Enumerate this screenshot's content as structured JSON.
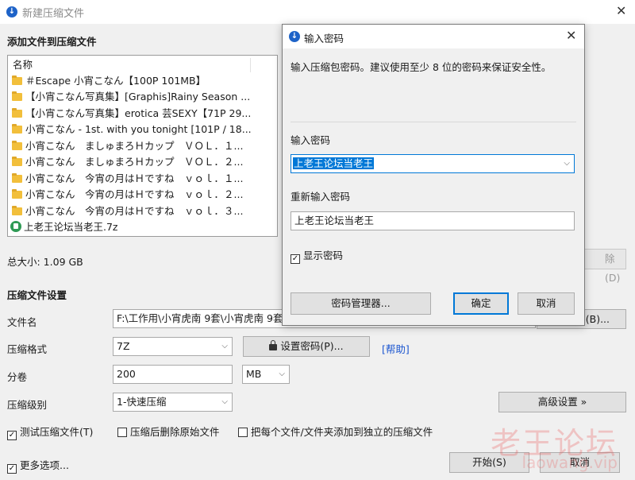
{
  "window": {
    "title": "新建压缩文件"
  },
  "files_section": {
    "heading": "添加文件到压缩文件",
    "column_name": "名称",
    "items": [
      {
        "name": "＃Escape 小宵こなん【100P 101MB】",
        "type": "folder"
      },
      {
        "name": "【小宵こなん写真集】[Graphis]Rainy Season ...",
        "type": "folder"
      },
      {
        "name": "【小宵こなん写真集】erotica 芸SEXY【71P 29...",
        "type": "folder"
      },
      {
        "name": "小宵こなん - 1st. with you tonight [101P / 18...",
        "type": "folder"
      },
      {
        "name": "小宵こなん　ましゅまろＨカップ　ＶＯＬ．１...",
        "type": "folder"
      },
      {
        "name": "小宵こなん　ましゅまろＨカップ　ＶＯＬ．２...",
        "type": "folder"
      },
      {
        "name": "小宵こなん　今宵の月はＨですね　ｖｏｌ．１...",
        "type": "folder"
      },
      {
        "name": "小宵こなん　今宵の月はＨですね　ｖｏｌ．２...",
        "type": "folder"
      },
      {
        "name": "小宵こなん　今宵の月はＨですね　ｖｏｌ．３...",
        "type": "folder"
      },
      {
        "name": "上老王论坛当老王.7z",
        "type": "archive"
      }
    ],
    "total_size": "总大小: 1.09 GB",
    "delete_label": "除(D)"
  },
  "settings": {
    "heading": "压缩文件设置",
    "filename_label": "文件名",
    "filename_value": "F:\\工作用\\小宵虎南 9套\\小宵虎南 9套",
    "browse_label": "览(B)...",
    "format_label": "压缩格式",
    "format_value": "7Z",
    "set_password_label": "设置密码(P)...",
    "help_label": "[帮助]",
    "split_label": "分卷",
    "split_value": "200",
    "split_unit": "MB",
    "level_label": "压缩级别",
    "level_value": "1-快速压缩",
    "advanced_label": "高级设置 »",
    "test_archive_label": "测试压缩文件(T)",
    "delete_source_label": "压缩后删除原始文件",
    "separate_archives_label": "把每个文件/文件夹添加到独立的压缩文件",
    "more_options_label": "更多选项...",
    "start_label": "开始(S)",
    "cancel_label": "取消"
  },
  "password_dialog": {
    "title": "输入密码",
    "description": "输入压缩包密码。建议使用至少 8 位的密码来保证安全性。",
    "password_label": "输入密码",
    "password_value": "上老王论坛当老王",
    "confirm_label": "重新输入密码",
    "confirm_value": "上老王论坛当老王",
    "show_password_label": "显示密码",
    "manager_label": "密码管理器...",
    "ok_label": "确定",
    "cancel_label": "取消"
  },
  "watermark": {
    "text": "老王论坛",
    "url": "laowang.vip"
  }
}
